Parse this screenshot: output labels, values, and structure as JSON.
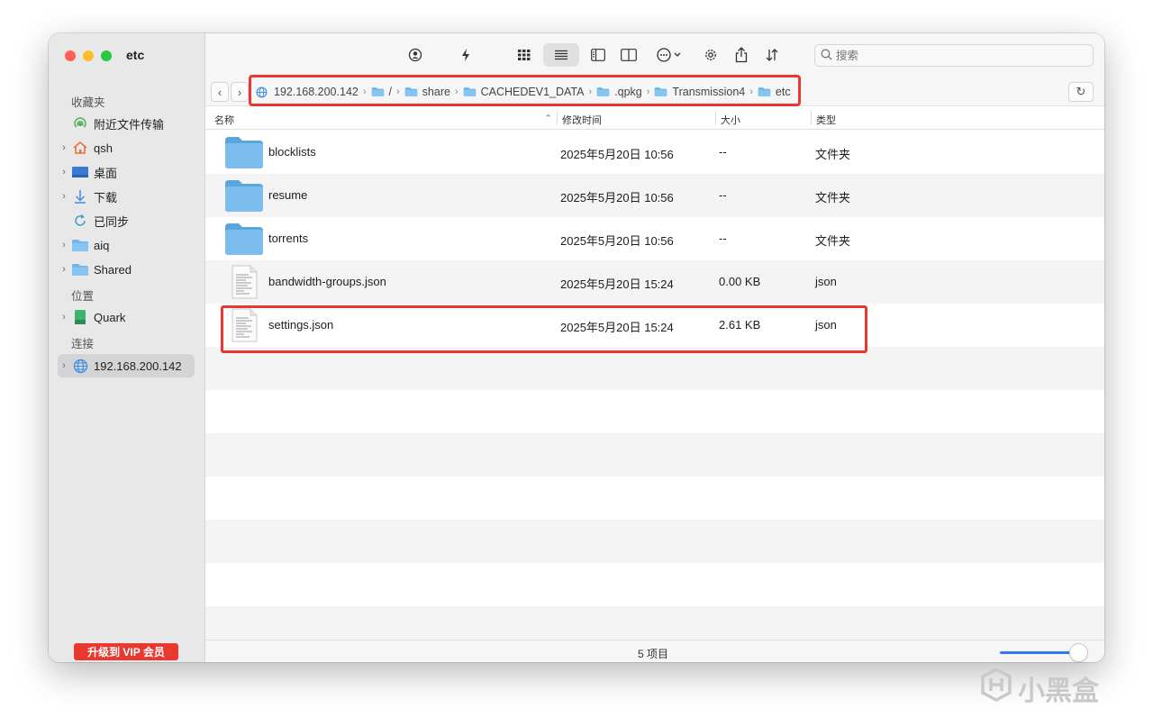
{
  "window": {
    "title": "etc"
  },
  "sidebar": {
    "sections": {
      "favorites": "收藏夹",
      "locations": "位置",
      "connections": "连接"
    },
    "items": [
      {
        "label": "附近文件传输",
        "icon": "airdrop-icon",
        "expandable": false
      },
      {
        "label": "qsh",
        "icon": "home-icon",
        "expandable": true
      },
      {
        "label": "桌面",
        "icon": "desktop-icon",
        "expandable": true
      },
      {
        "label": "下载",
        "icon": "download-icon",
        "expandable": true
      },
      {
        "label": "已同步",
        "icon": "sync-icon",
        "expandable": false
      },
      {
        "label": "aiq",
        "icon": "folder-icon",
        "expandable": true
      },
      {
        "label": "Shared",
        "icon": "folder-icon",
        "expandable": true
      },
      {
        "label": "Quark",
        "icon": "drive-icon",
        "expandable": true
      },
      {
        "label": "192.168.200.142",
        "icon": "network-icon",
        "expandable": true,
        "selected": true
      }
    ],
    "vip_button": "升级到 VIP 会员"
  },
  "toolbar": {
    "search_placeholder": "搜索"
  },
  "path": {
    "crumbs": [
      "192.168.200.142",
      "/",
      "share",
      "CACHEDEV1_DATA",
      ".qpkg",
      "Transmission4",
      "etc"
    ]
  },
  "columns": {
    "name": "名称",
    "modified": "修改时间",
    "size": "大小",
    "kind": "类型"
  },
  "files": [
    {
      "name": "blocklists",
      "modified": "2025年5月20日 10:56",
      "size": "--",
      "kind": "文件夹",
      "type": "folder"
    },
    {
      "name": "resume",
      "modified": "2025年5月20日 10:56",
      "size": "--",
      "kind": "文件夹",
      "type": "folder"
    },
    {
      "name": "torrents",
      "modified": "2025年5月20日 10:56",
      "size": "--",
      "kind": "文件夹",
      "type": "folder"
    },
    {
      "name": "bandwidth-groups.json",
      "modified": "2025年5月20日 15:24",
      "size": "0.00 KB",
      "kind": "json",
      "type": "file"
    },
    {
      "name": "settings.json",
      "modified": "2025年5月20日 15:24",
      "size": "2.61 KB",
      "kind": "json",
      "type": "file"
    }
  ],
  "status": {
    "text": "5 项目"
  },
  "watermark": {
    "text": "小黑盒"
  },
  "colors": {
    "accent": "#3478f6",
    "highlight": "#e8382f",
    "folder": "#6cb4ea"
  }
}
